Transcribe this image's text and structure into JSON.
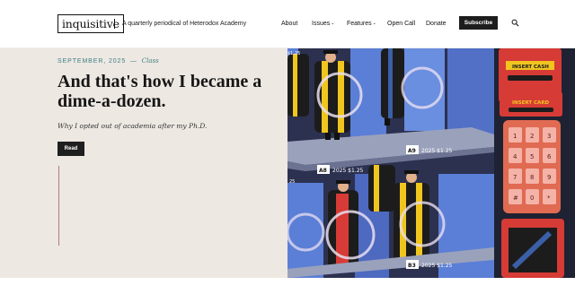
{
  "header": {
    "logo_text": "inquisitive",
    "tagline": "A quarterly periodical of Heterodox Academy",
    "nav": {
      "about": "About",
      "issues": "Issues",
      "features": "Features",
      "open_call": "Open Call",
      "donate": "Donate",
      "subscribe": "Subscribe"
    },
    "caret": "⌄"
  },
  "hero": {
    "date": "SEPTEMBER, 2025",
    "dash": "—",
    "category": "Class",
    "headline": "And that's how I became a dime-a-dozen.",
    "dek": "Why I opted out of academia after my Ph.D.",
    "read_label": "Read"
  },
  "illustration": {
    "labels": {
      "insert_cash": "INSERT CASH",
      "insert_card": "INSERT CARD",
      "slot_a9": "A9",
      "price_a9": "2025 $1.25",
      "slot_a8": "A8",
      "price_a8": "2025 $1.25",
      "slot_b3": "B3",
      "price_b3": "2025 $1.25",
      "price_top": "$1.25",
      "price_left": "25"
    },
    "keypad": [
      "1",
      "2",
      "3",
      "4",
      "5",
      "6",
      "7",
      "8",
      "9",
      "#",
      "0",
      "*"
    ],
    "colors": {
      "machine_dark": "#1f2337",
      "glass_blue": "#5b7fd6",
      "shelf_gray": "#8f96b0",
      "gown_black": "#1c1c1c",
      "trim_yellow": "#f0c51e",
      "panel_red": "#d63b36",
      "key_pink": "#f5b3a8"
    }
  }
}
